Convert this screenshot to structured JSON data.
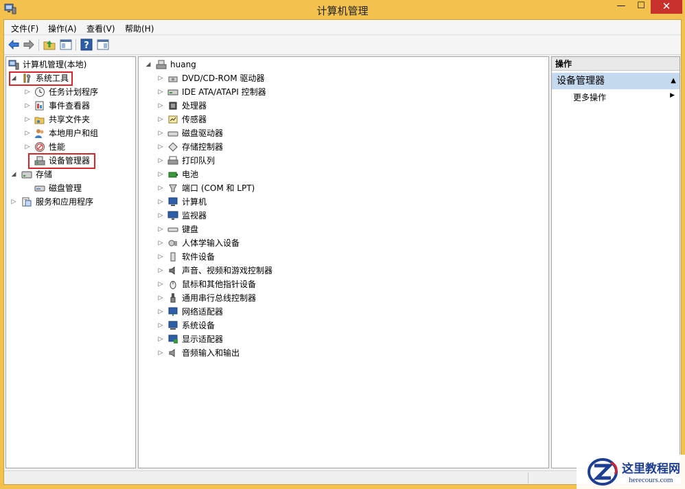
{
  "window": {
    "title": "计算机管理",
    "controls": {
      "minimize": "—",
      "maximize": "☐",
      "close": "✕"
    }
  },
  "menubar": {
    "items": [
      "文件(F)",
      "操作(A)",
      "查看(V)",
      "帮助(H)"
    ]
  },
  "toolbar": {
    "buttons": [
      "back-icon",
      "forward-icon",
      "up-folder-icon",
      "show-hide-tree-icon",
      "help-icon",
      "show-hide-action-pane-icon"
    ]
  },
  "tree": {
    "root": "计算机管理(本地)",
    "system_tools": "系统工具",
    "task_scheduler": "任务计划程序",
    "event_viewer": "事件查看器",
    "shared_folders": "共享文件夹",
    "local_users": "本地用户和组",
    "performance": "性能",
    "device_manager": "设备管理器",
    "storage": "存储",
    "disk_management": "磁盘管理",
    "services_apps": "服务和应用程序"
  },
  "devices": {
    "computer_name": "huang",
    "categories": [
      "DVD/CD-ROM 驱动器",
      "IDE ATA/ATAPI 控制器",
      "处理器",
      "传感器",
      "磁盘驱动器",
      "存储控制器",
      "打印队列",
      "电池",
      "端口 (COM 和 LPT)",
      "计算机",
      "监视器",
      "键盘",
      "人体学输入设备",
      "软件设备",
      "声音、视频和游戏控制器",
      "鼠标和其他指针设备",
      "通用串行总线控制器",
      "网络适配器",
      "系统设备",
      "显示适配器",
      "音频输入和输出"
    ]
  },
  "actions": {
    "header": "操作",
    "section": "设备管理器",
    "more": "更多操作"
  },
  "watermark": {
    "text": "这里教程网",
    "url": "herecours.com"
  },
  "colors": {
    "titlebar": "#f2c14e",
    "close_button": "#c7302b",
    "highlight_box": "#d9262b",
    "action_section": "#c5d9ef"
  }
}
